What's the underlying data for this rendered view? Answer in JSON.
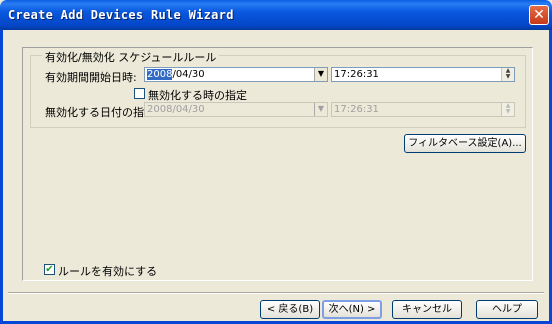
{
  "window": {
    "title": "Create Add Devices Rule Wizard",
    "close_glyph": "✕"
  },
  "group": {
    "legend": "有効化/無効化 スケジュールルール",
    "start_label": "有効期間開始日時:",
    "start_date_selected": "2008",
    "start_date_rest": "/04/30",
    "start_time": "17:26:31",
    "disable_checkbox_label": "無効化する時の指定",
    "disable_checkbox_checked": false,
    "end_label": "無効化する日付の指定:",
    "end_date": "2008/04/30",
    "end_time": "17:26:31"
  },
  "filter_button": "フィルタベース設定(A)...",
  "enable_rule": {
    "label": "ルールを有効にする",
    "checked": true,
    "check_glyph": "✔"
  },
  "buttons": {
    "back": "< 戻る(B)",
    "next": "次へ(N) >",
    "cancel": "キャンセル",
    "help": "ヘルプ"
  },
  "glyphs": {
    "dropdown": "▼",
    "spin_up": "▲",
    "spin_down": "▼"
  }
}
